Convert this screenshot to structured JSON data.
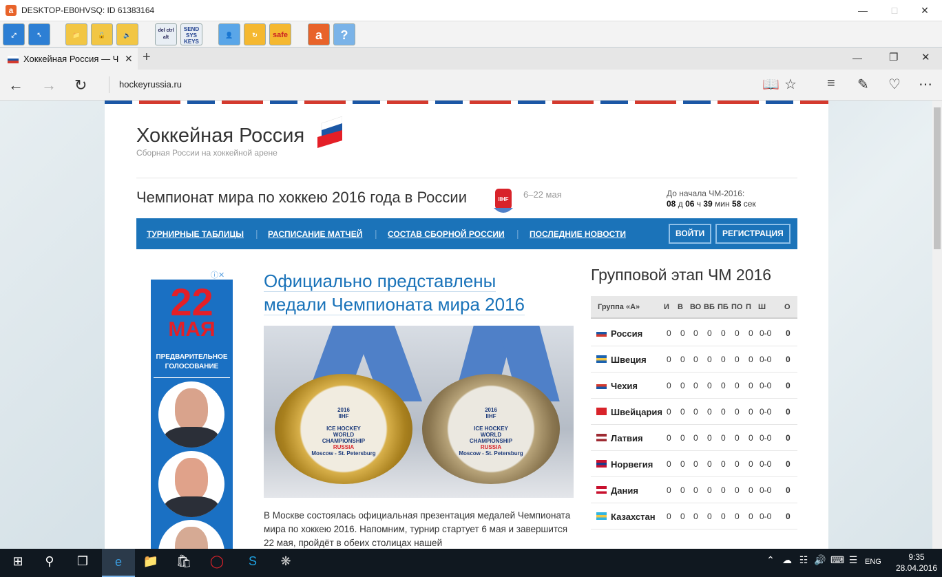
{
  "remote": {
    "title": "DESKTOP-EB0HVSQ: ID 61383164",
    "app_icon_letter": "a",
    "toolbar": [
      "del ctrl alt",
      "SEND SYS KEYS",
      "safe",
      "?"
    ]
  },
  "browser": {
    "tab_title": "Хоккейная Россия — Ч",
    "url": "hockeyrussia.ru"
  },
  "site": {
    "brand": "Хоккейная Россия",
    "tagline": "Сборная России на хоккейной арене",
    "championship": "Чемпионат мира по хоккею 2016 года в России",
    "iihf_label": "IIHF",
    "dates": "6–22 мая",
    "countdown_label": "До начала ЧМ-2016:",
    "countdown": {
      "days": "08",
      "d": "д",
      "hours": "06",
      "h": "ч",
      "minutes": "39",
      "m": "мин",
      "seconds": "58",
      "s": "сек"
    },
    "nav": [
      "ТУРНИРНЫЕ ТАБЛИЦЫ",
      "РАСПИСАНИЕ МАТЧЕЙ",
      "СОСТАВ СБОРНОЙ РОССИИ",
      "ПОСЛЕДНИЕ НОВОСТИ"
    ],
    "login": "ВОЙТИ",
    "register": "РЕГИСТРАЦИЯ"
  },
  "ad": {
    "number": "22",
    "month": "МАЯ",
    "line1": "ПРЕДВАРИТЕЛЬНОЕ",
    "line2": "ГОЛОСОВАНИЕ",
    "info": "ⓘ✕"
  },
  "article": {
    "title": "Официально представлены медали Чемпионата мира 2016",
    "medal_text": [
      "2016",
      "IIHF",
      "ICE HOCKEY",
      "WORLD",
      "CHAMPIONSHIP",
      "RUSSIA",
      "Moscow - St. Petersburg"
    ],
    "body": "В Москве состоялась официальная презентация медалей Чемпионата мира по хоккею 2016. Напомним, турнир стартует 6 мая и завершится 22 мая, пройдёт в обеих столицах нашей"
  },
  "standings": {
    "title": "Групповой этап ЧМ 2016",
    "headers": [
      "Группа «А»",
      "И",
      "В",
      "ВО",
      "ВБ",
      "ПБ",
      "ПО",
      "П",
      "Ш",
      "О"
    ],
    "rows": [
      {
        "country": "Россия",
        "vals": [
          "0",
          "0",
          "0",
          "0",
          "0",
          "0",
          "0",
          "0-0",
          "0"
        ]
      },
      {
        "country": "Швеция",
        "vals": [
          "0",
          "0",
          "0",
          "0",
          "0",
          "0",
          "0",
          "0-0",
          "0"
        ]
      },
      {
        "country": "Чехия",
        "vals": [
          "0",
          "0",
          "0",
          "0",
          "0",
          "0",
          "0",
          "0-0",
          "0"
        ]
      },
      {
        "country": "Швейцария",
        "vals": [
          "0",
          "0",
          "0",
          "0",
          "0",
          "0",
          "0",
          "0-0",
          "0"
        ]
      },
      {
        "country": "Латвия",
        "vals": [
          "0",
          "0",
          "0",
          "0",
          "0",
          "0",
          "0",
          "0-0",
          "0"
        ]
      },
      {
        "country": "Норвегия",
        "vals": [
          "0",
          "0",
          "0",
          "0",
          "0",
          "0",
          "0",
          "0-0",
          "0"
        ]
      },
      {
        "country": "Дания",
        "vals": [
          "0",
          "0",
          "0",
          "0",
          "0",
          "0",
          "0",
          "0-0",
          "0"
        ]
      },
      {
        "country": "Казахстан",
        "vals": [
          "0",
          "0",
          "0",
          "0",
          "0",
          "0",
          "0",
          "0-0",
          "0"
        ]
      }
    ]
  },
  "taskbar": {
    "lang": "ENG",
    "time": "9:35",
    "date": "28.04.2016"
  },
  "colors": {
    "nav_blue": "#1b73b9",
    "link_blue": "#1a73b9",
    "flag_red": "#e41f27"
  }
}
